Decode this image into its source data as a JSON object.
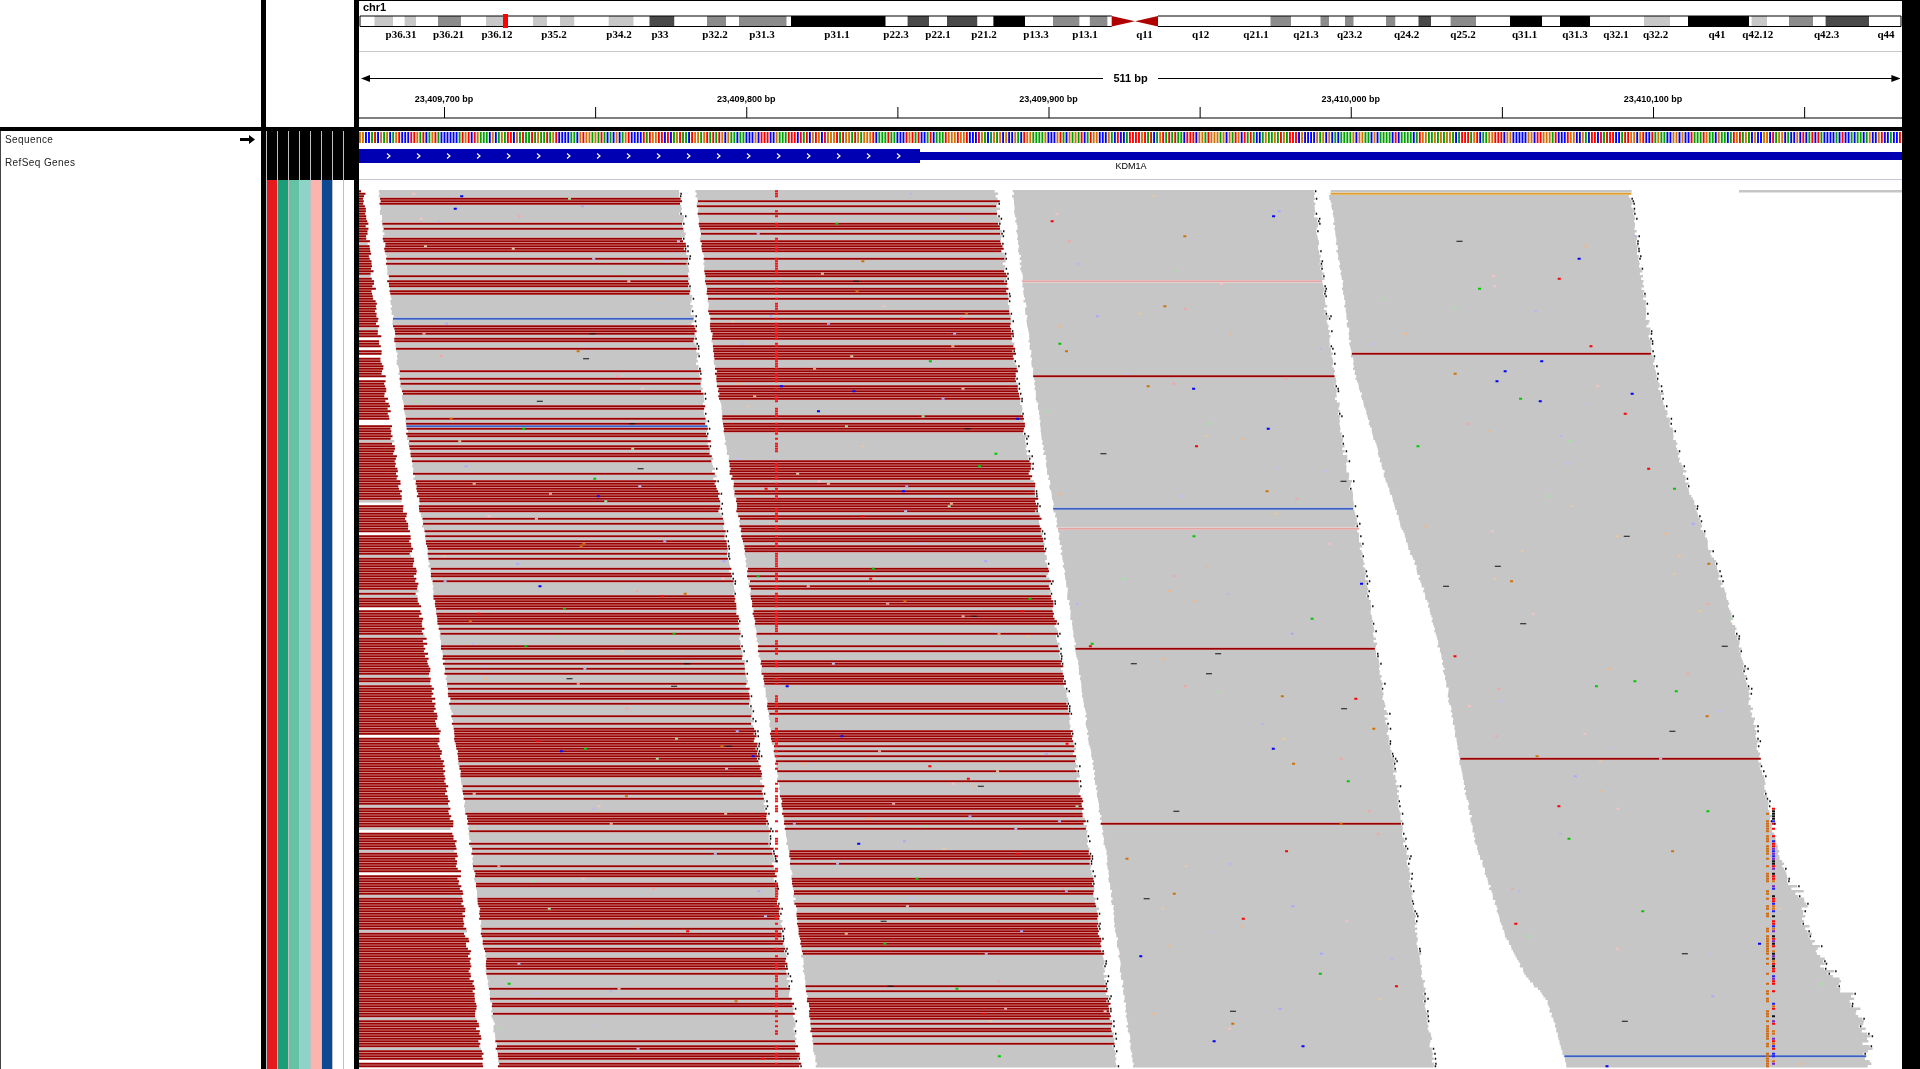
{
  "ideogram": {
    "chromosome": "chr1",
    "band_labels": [
      "p36.31",
      "p36.21",
      "p36.12",
      "p35.2",
      "p34.2",
      "p33",
      "p32.2",
      "p31.3",
      "p31.1",
      "p22.3",
      "p22.1",
      "p21.2",
      "p13.3",
      "p13.1",
      "q11",
      "q12",
      "q21.1",
      "q21.3",
      "q23.2",
      "q24.2",
      "q25.2",
      "q31.1",
      "q31.3",
      "q32.1",
      "q32.2",
      "q41",
      "q42.12",
      "q42.3",
      "q44"
    ]
  },
  "ruler": {
    "span": "511 bp",
    "ticks": [
      "23,409,700 bp",
      "23,409,800 bp",
      "23,409,900 bp",
      "23,410,000 bp",
      "23,410,100 bp"
    ]
  },
  "tracks": [
    {
      "kind": "sequence",
      "name": "Sequence",
      "forward": true
    },
    {
      "kind": "gene",
      "name": "RefSeq Genes",
      "features": [
        {
          "name": "KDM1A",
          "forward": true
        }
      ]
    },
    {
      "kind": "alignment",
      "attributes": [
        {
          "color": "#e41a1c"
        },
        {
          "color": "#1b9e77"
        },
        {
          "color": "#66c2a5"
        },
        {
          "color": "#8dd3c7"
        },
        {
          "color": "#fbb4ae"
        },
        {
          "color": "#0b4a92"
        },
        {
          "color": "#ffffff"
        },
        {
          "color": "#ffffff"
        }
      ]
    }
  ]
}
